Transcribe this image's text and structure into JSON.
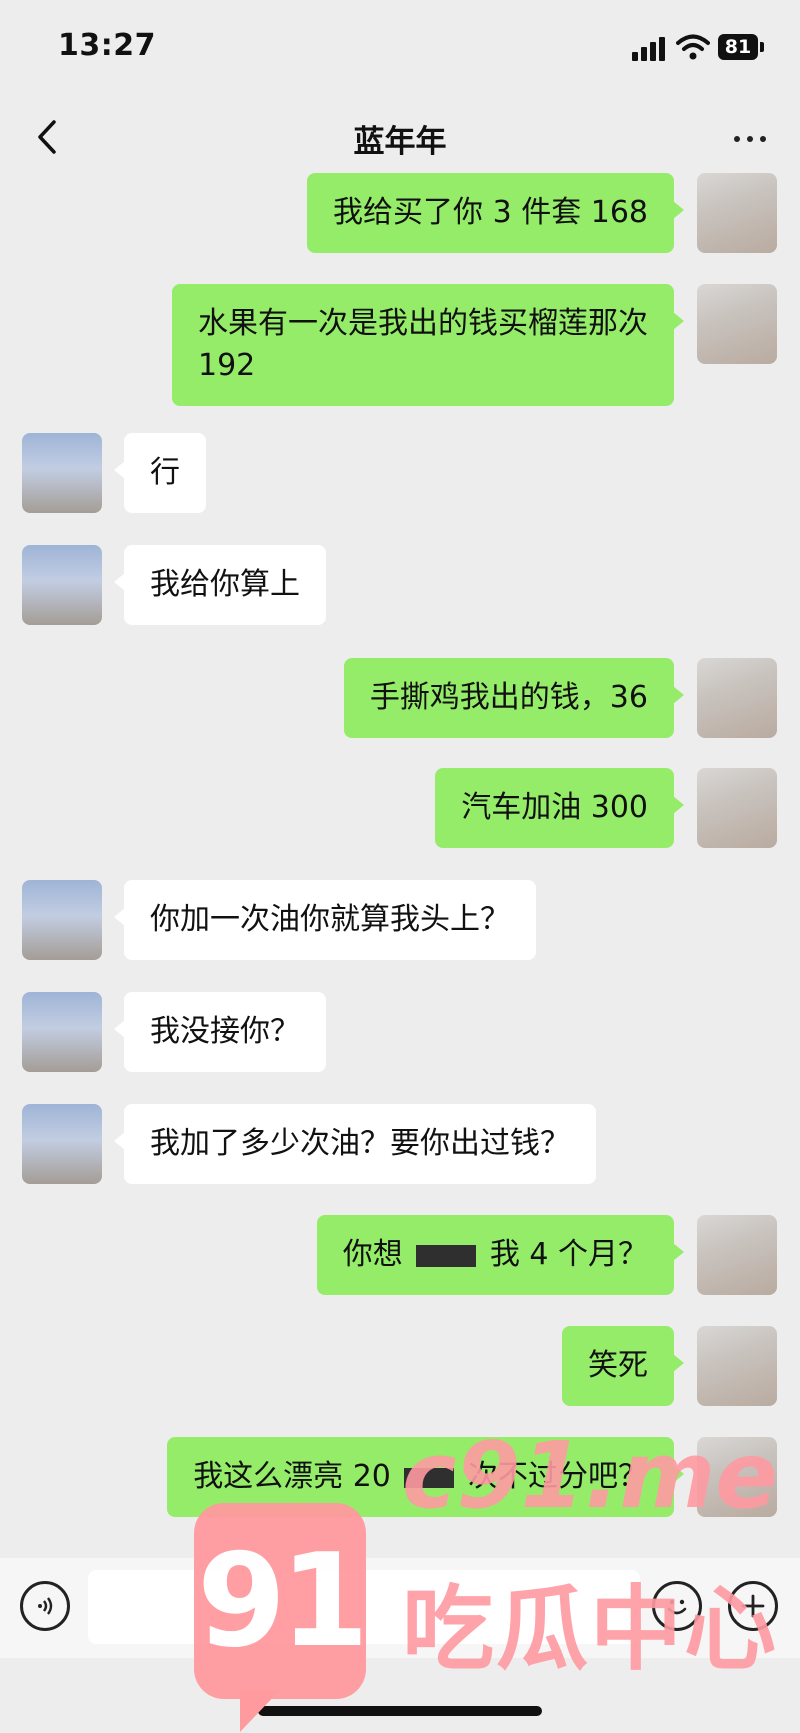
{
  "status_bar": {
    "time": "13:27",
    "battery": "81"
  },
  "header": {
    "title": "蓝年年"
  },
  "messages": [
    {
      "side": "out",
      "text": "我给买了你 3 件套 168"
    },
    {
      "side": "out",
      "text_line1": "水果有一次是我出的钱买榴莲那次",
      "text_line2": "192"
    },
    {
      "side": "in",
      "text": "行"
    },
    {
      "side": "in",
      "text": "我给你算上"
    },
    {
      "side": "out",
      "text": "手撕鸡我出的钱，36"
    },
    {
      "side": "out",
      "text": "汽车加油 300"
    },
    {
      "side": "in",
      "text": "你加一次油你就算我头上？"
    },
    {
      "side": "in",
      "text": "我没接你？"
    },
    {
      "side": "in",
      "text": "我加了多少次油？要你出过钱？"
    },
    {
      "side": "out",
      "text_before": "你想",
      "text_after": "我 4 个月？"
    },
    {
      "side": "out",
      "text": "笑死"
    },
    {
      "side": "out",
      "text_before": "我这么漂亮 20",
      "text_after": "次不过分吧？"
    }
  ],
  "watermark": {
    "badge": "91",
    "url": "c91.me",
    "name": "吃瓜中心"
  },
  "colors": {
    "sent_bubble": "#95ec69",
    "received_bubble": "#ffffff",
    "background": "#ededed",
    "watermark": "#ff9aa2"
  },
  "icons": [
    "back-chevron-icon",
    "more-dots-icon",
    "voice-icon",
    "emoji-icon",
    "plus-icon",
    "signal-icon",
    "wifi-icon",
    "battery-icon"
  ]
}
